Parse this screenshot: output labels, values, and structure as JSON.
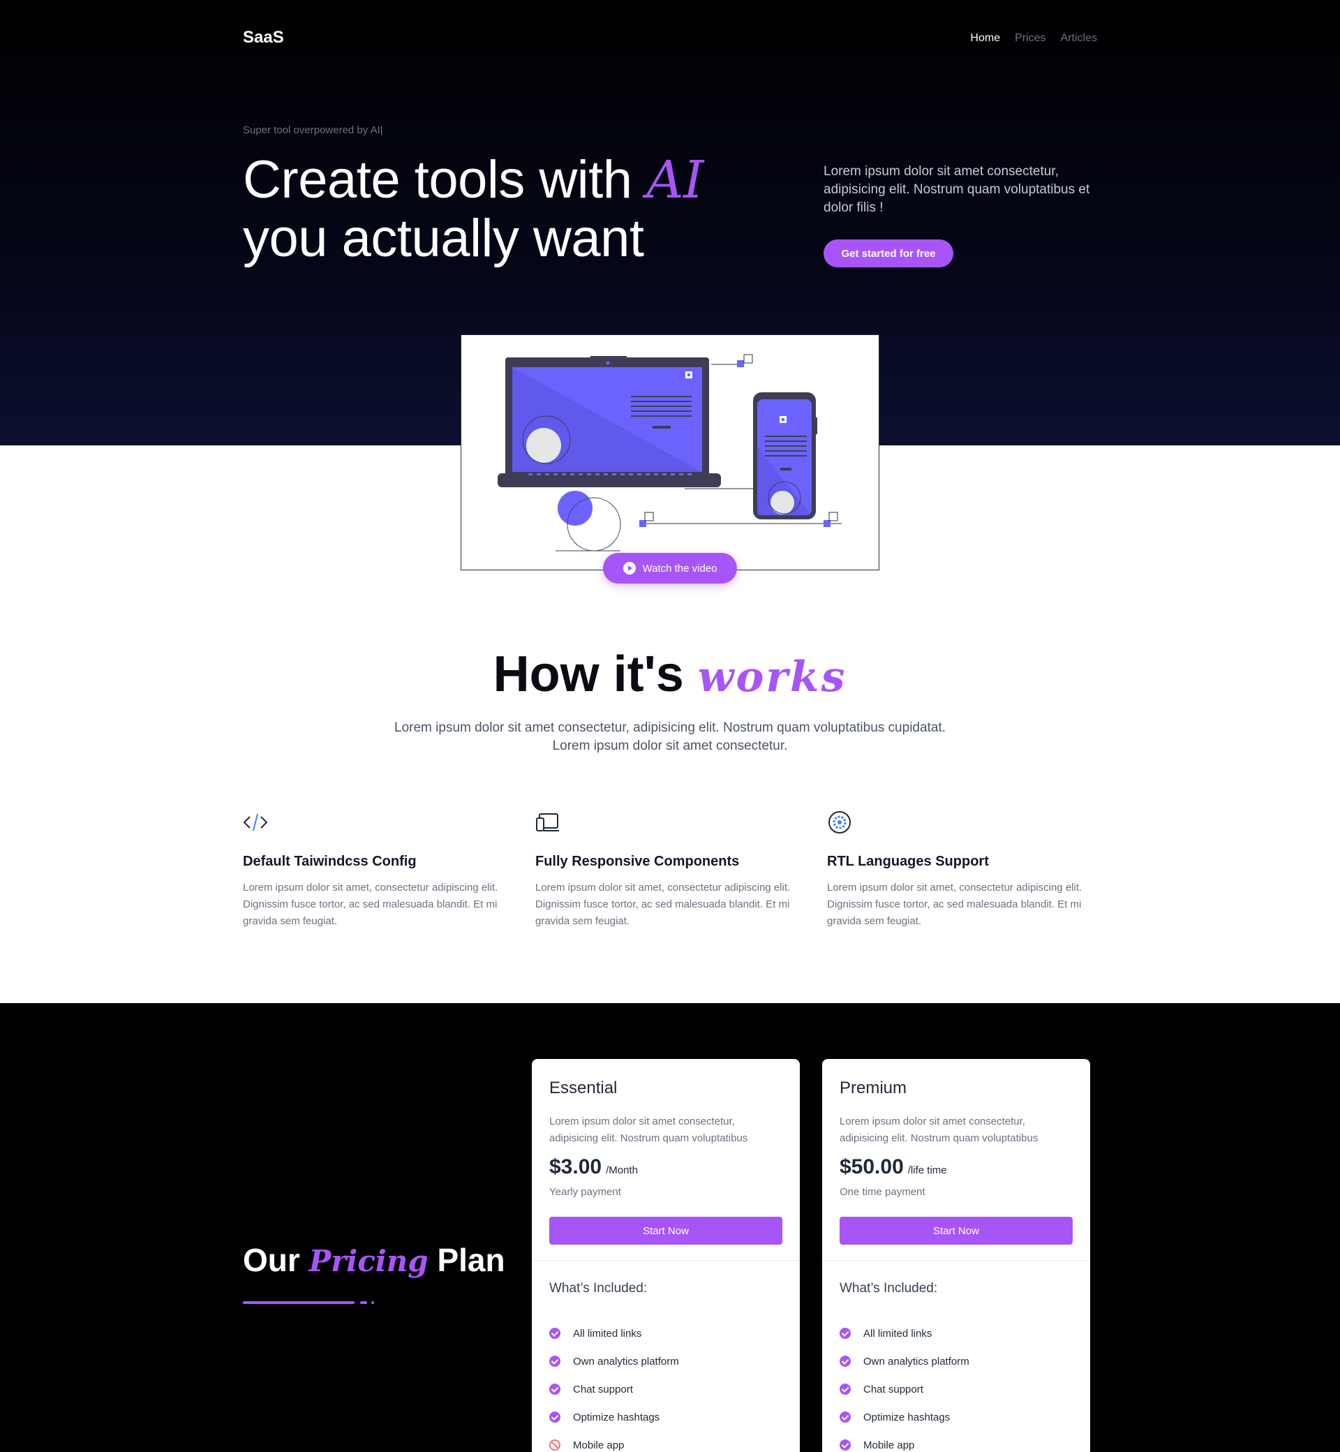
{
  "nav": {
    "brand": "SaaS",
    "links": [
      "Home",
      "Prices",
      "Articles"
    ]
  },
  "hero": {
    "eyebrow": "Super tool overpowered by AI|",
    "title_line1": "Create tools with ",
    "title_accent": "AI",
    "title_line2": "you actually want",
    "description": "Lorem ipsum dolor sit amet consectetur, adipisicing elit. Nostrum quam voluptatibus et dolor filis !",
    "cta_label": "Get started for free"
  },
  "video": {
    "button_label": "Watch the video"
  },
  "how": {
    "title_main": "How it's ",
    "title_accent": "works",
    "description": "Lorem ipsum dolor sit amet consectetur, adipisicing elit. Nostrum quam voluptatibus cupidatat. Lorem ipsum dolor sit amet consectetur.",
    "features": [
      {
        "icon": "code-icon",
        "title": "Default Taiwindcss Config",
        "text": "Lorem ipsum dolor sit amet, consectetur adipiscing elit. Dignissim fusce tortor, ac sed malesuada blandit. Et mi gravida sem feugiat."
      },
      {
        "icon": "devices-icon",
        "title": "Fully Responsive Components",
        "text": "Lorem ipsum dolor sit amet, consectetur adipiscing elit. Dignissim fusce tortor, ac sed malesuada blandit. Et mi gravida sem feugiat."
      },
      {
        "icon": "globe-gear-icon",
        "title": "RTL Languages Support",
        "text": "Lorem ipsum dolor sit amet, consectetur adipiscing elit. Dignissim fusce tortor, ac sed malesuada blandit. Et mi gravida sem feugiat."
      }
    ]
  },
  "pricing": {
    "title_start": "Our ",
    "title_accent": "Pricing",
    "title_end": " Plan",
    "plans": [
      {
        "name": "Essential",
        "description": "Lorem ipsum dolor sit amet consectetur, adipisicing elit. Nostrum quam voluptatibus",
        "price": "$3.00",
        "period": "/Month",
        "payment": "Yearly payment",
        "button": "Start Now",
        "included_label": "What’s Included:",
        "features": [
          {
            "label": "All limited links",
            "included": true
          },
          {
            "label": "Own analytics platform",
            "included": true
          },
          {
            "label": "Chat support",
            "included": true
          },
          {
            "label": "Optimize hashtags",
            "included": true
          },
          {
            "label": "Mobile app",
            "included": false
          }
        ]
      },
      {
        "name": "Premium",
        "description": "Lorem ipsum dolor sit amet consectetur, adipisicing elit. Nostrum quam voluptatibus",
        "price": "$50.00",
        "period": "/life time",
        "payment": "One time payment",
        "button": "Start Now",
        "included_label": "What’s Included:",
        "features": [
          {
            "label": "All limited links",
            "included": true
          },
          {
            "label": "Own analytics platform",
            "included": true
          },
          {
            "label": "Chat support",
            "included": true
          },
          {
            "label": "Optimize hashtags",
            "included": true
          },
          {
            "label": "Mobile app",
            "included": true
          }
        ]
      }
    ]
  },
  "colors": {
    "accent": "#a855f7",
    "illustration": "#6c63ff",
    "dark": "#000000"
  }
}
